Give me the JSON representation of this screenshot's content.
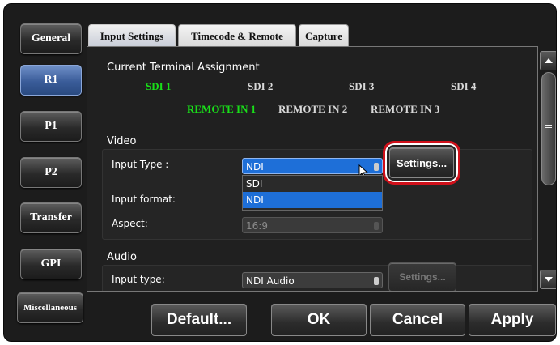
{
  "sidebar": {
    "items": [
      {
        "label": "General",
        "active": false
      },
      {
        "label": "R1",
        "active": true
      },
      {
        "label": "P1",
        "active": false
      },
      {
        "label": "P2",
        "active": false
      },
      {
        "label": "Transfer",
        "active": false
      },
      {
        "label": "GPI",
        "active": false
      },
      {
        "label": "Miscellaneous",
        "active": false
      }
    ]
  },
  "tabs": [
    {
      "label": "Input Settings",
      "active": true
    },
    {
      "label": "Timecode & Remote",
      "active": false
    },
    {
      "label": "Capture",
      "active": false
    }
  ],
  "terminal": {
    "title": "Current Terminal Assignment",
    "sdi": [
      "SDI 1",
      "SDI 2",
      "SDI 3",
      "SDI 4"
    ],
    "remote": [
      "REMOTE IN 1",
      "REMOTE IN 2",
      "REMOTE IN 3"
    ],
    "active_color": "#19e019"
  },
  "video": {
    "title": "Video",
    "input_type_label": "Input Type :",
    "input_type_value": "NDI",
    "input_type_options": [
      "SDI",
      "NDI"
    ],
    "input_format_label": "Input format:",
    "aspect_label": "Aspect:",
    "aspect_value": "16:9",
    "settings_label": "Settings..."
  },
  "audio": {
    "title": "Audio",
    "input_type_label": "Input type:",
    "input_type_value": "NDI Audio",
    "settings_label": "Settings..."
  },
  "footer": {
    "default_label": "Default...",
    "ok_label": "OK",
    "cancel_label": "Cancel",
    "apply_label": "Apply"
  },
  "colors": {
    "highlight_ring": "#d0101a",
    "selection_blue": "#1e6fd8"
  }
}
